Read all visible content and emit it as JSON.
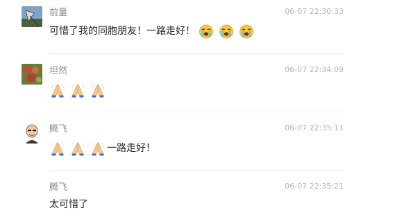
{
  "comments": [
    {
      "author": "前量",
      "time": "06-07 22:30:33",
      "text": "可惜了我的同胞朋友！一路走好！",
      "emojis": [
        "crying-face-emoji",
        "crying-face-emoji",
        "crying-face-emoji"
      ],
      "avatar": "avatar-kite"
    },
    {
      "author": "坦然",
      "time": "06-07 22:34:09",
      "text": "",
      "emojis": [
        "folded-hands-emoji",
        "folded-hands-emoji",
        "folded-hands-emoji"
      ],
      "avatar": "avatar-food"
    },
    {
      "author": "腾飞",
      "time": "06-07 22:35:11",
      "text": "一路走好！",
      "emojis": [
        "folded-hands-emoji",
        "folded-hands-emoji",
        "folded-hands-emoji"
      ],
      "avatar": "avatar-cartoon-man"
    },
    {
      "author": "腾飞",
      "time": "06-07 22:35:21",
      "text": "太可惜了",
      "emojis": [],
      "avatar": ""
    }
  ],
  "colors": {
    "author": "#8c8c8c",
    "time": "#b5b5b5",
    "text": "#222222",
    "divider": "#ececec"
  }
}
